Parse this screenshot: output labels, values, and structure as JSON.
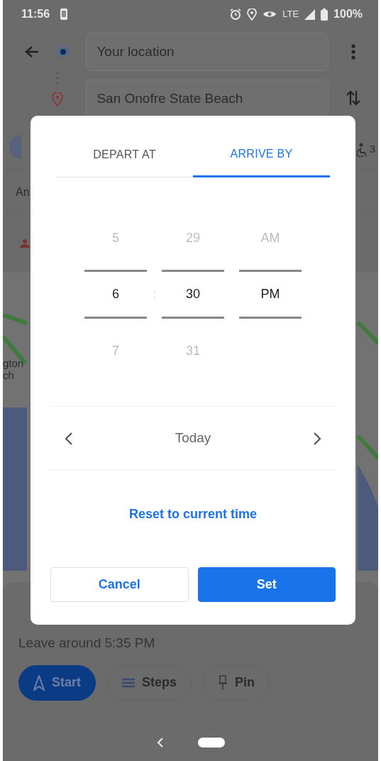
{
  "status_bar": {
    "time": "11:56",
    "network": "LTE",
    "battery": "100%"
  },
  "route": {
    "origin": "Your location",
    "destination": "San Onofre State Beach"
  },
  "mode_row": {
    "count": "3"
  },
  "info_row": {
    "text": "An"
  },
  "map": {
    "labels": [
      "gton",
      "ch"
    ]
  },
  "trip": {
    "leave_text": "Leave around 5:35 PM",
    "buttons": [
      {
        "label": "Start",
        "kind": "start"
      },
      {
        "label": "Steps",
        "kind": "steps"
      },
      {
        "label": "Pin",
        "kind": "pin"
      }
    ]
  },
  "dialog": {
    "tabs": [
      {
        "label": "DEPART AT",
        "selected": false
      },
      {
        "label": "ARRIVE BY",
        "selected": true
      }
    ],
    "picker": {
      "separator": ":",
      "columns": [
        {
          "above": "5",
          "value": "6",
          "below": "7"
        },
        {
          "above": "29",
          "value": "30",
          "below": "31"
        },
        {
          "above": "AM",
          "value": "PM"
        }
      ]
    },
    "date": {
      "label": "Today"
    },
    "reset_link": "Reset to current time",
    "buttons": [
      {
        "label": "Cancel",
        "kind": "outline"
      },
      {
        "label": "Set",
        "kind": "primary"
      }
    ]
  }
}
